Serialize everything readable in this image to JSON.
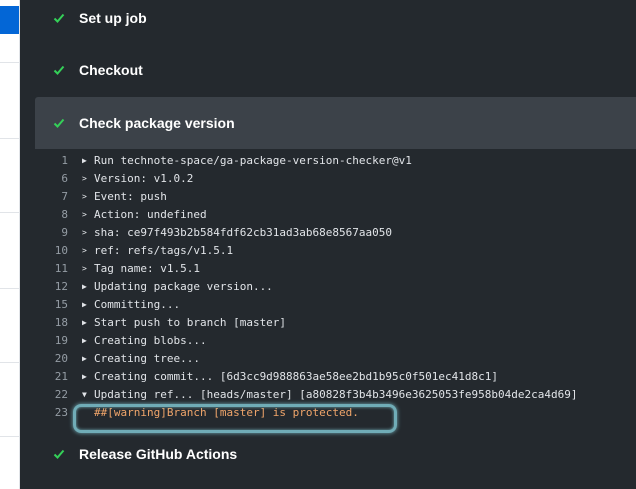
{
  "steps": {
    "setup_label": "Set up job",
    "checkout_label": "Checkout",
    "check_version_label": "Check package version",
    "release_label": "Release GitHub Actions"
  },
  "log": [
    {
      "num": "1",
      "marker": "▶",
      "text": "Run technote-space/ga-package-version-checker@v1"
    },
    {
      "num": "6",
      "marker": ">",
      "text": "Version: v1.0.2"
    },
    {
      "num": "7",
      "marker": ">",
      "text": "Event: push"
    },
    {
      "num": "8",
      "marker": ">",
      "text": "Action: undefined"
    },
    {
      "num": "9",
      "marker": ">",
      "text": "sha: ce97f493b2b584fdf62cb31ad3ab68e8567aa050"
    },
    {
      "num": "10",
      "marker": ">",
      "text": "ref: refs/tags/v1.5.1"
    },
    {
      "num": "11",
      "marker": ">",
      "text": "Tag name: v1.5.1"
    },
    {
      "num": "12",
      "marker": "▶",
      "text": "Updating package version..."
    },
    {
      "num": "15",
      "marker": "▶",
      "text": "Committing..."
    },
    {
      "num": "18",
      "marker": "▶",
      "text": "Start push to branch [master]"
    },
    {
      "num": "19",
      "marker": "▶",
      "text": "Creating blobs..."
    },
    {
      "num": "20",
      "marker": "▶",
      "text": "Creating tree..."
    },
    {
      "num": "21",
      "marker": "▶",
      "text": "Creating commit... [6d3cc9d988863ae58ee2bd1b95c0f501ec41d8c1]"
    },
    {
      "num": "22",
      "marker": "▼",
      "text": "Updating ref... [heads/master] [a80828f3b4b3496e3625053fe958b04de2ca4d69]"
    },
    {
      "num": "23",
      "marker": "",
      "text": "##[warning]Branch [master] is protected."
    }
  ],
  "colors": {
    "success": "#34d058",
    "warning": "#f0a56a",
    "highlight": "#7ec4cf"
  }
}
